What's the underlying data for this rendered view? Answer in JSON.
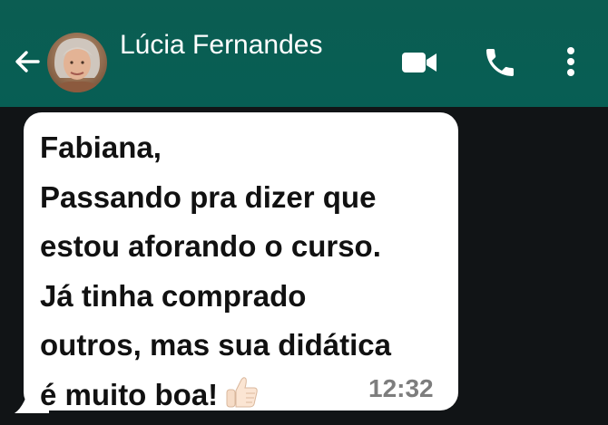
{
  "header": {
    "contact_name": "Lúcia Fernandes",
    "background_color": "#075e54",
    "icons": {
      "back": "back-arrow-icon",
      "avatar": "contact-avatar",
      "video": "video-call-icon",
      "call": "phone-icon",
      "menu": "more-vert-icon"
    }
  },
  "chat": {
    "background_color": "#111416",
    "message": {
      "text_before_emoji": "Fabiana,\nPassando pra dizer que\nestou aforando o curso.\nJá tinha comprado\noutros, mas sua didática\né muito boa!",
      "emoji": "thumbs-up-icon",
      "time": "12:32",
      "bubble_color": "#ffffff"
    }
  }
}
